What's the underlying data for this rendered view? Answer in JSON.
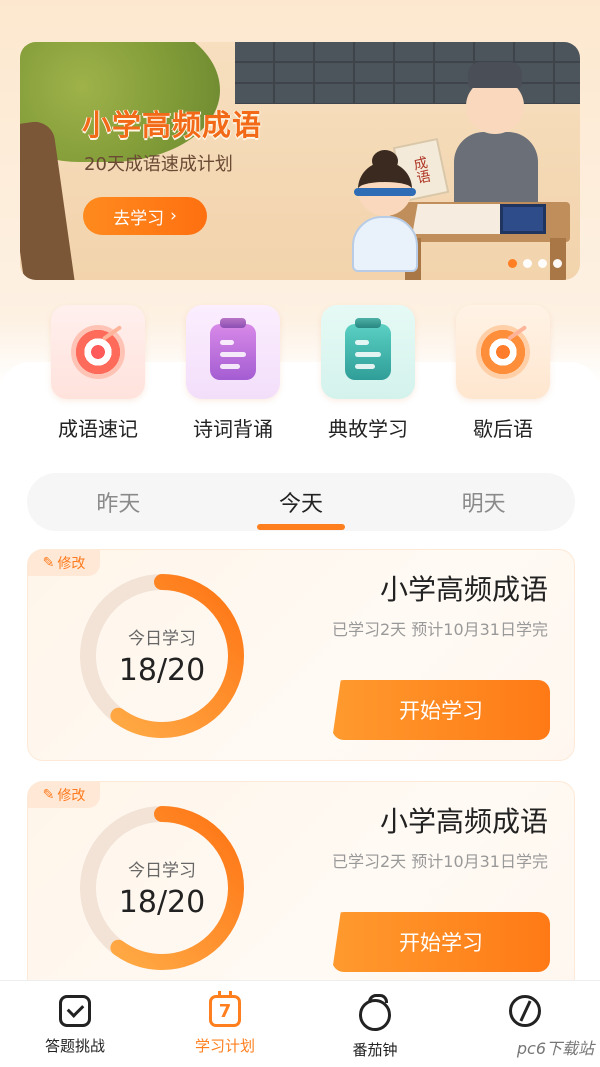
{
  "banner": {
    "title": "小学高频成语",
    "subtitle": "20天成语速成计划",
    "cta": "去学习",
    "cta_icon": "chevron-right-icon",
    "scroll_text": "成语",
    "slides": 4,
    "active_slide": 0
  },
  "categories": [
    {
      "label": "成语速记",
      "icon": "target-icon",
      "color": "#ff6b5a"
    },
    {
      "label": "诗词背诵",
      "icon": "clipboard-icon",
      "color": "#c46bd9"
    },
    {
      "label": "典故学习",
      "icon": "clipboard-icon",
      "color": "#3fb8ae"
    },
    {
      "label": "歇后语",
      "icon": "target-icon",
      "color": "#ff8a2e"
    }
  ],
  "tabs": {
    "items": [
      "昨天",
      "今天",
      "明天"
    ],
    "active": 1
  },
  "plans": [
    {
      "edit_label": "修改",
      "ring_label": "今日学习",
      "progress_text": "18/20",
      "progress": 0.6,
      "title": "小学高频成语",
      "meta": "已学习2天 预计10月31日学完",
      "start_label": "开始学习"
    },
    {
      "edit_label": "修改",
      "ring_label": "今日学习",
      "progress_text": "18/20",
      "progress": 0.6,
      "title": "小学高频成语",
      "meta": "已学习2天 预计10月31日学完",
      "start_label": "开始学习"
    }
  ],
  "nav": {
    "items": [
      {
        "label": "答题挑战",
        "icon": "checkbox-icon"
      },
      {
        "label": "学习计划",
        "icon": "calendar-icon",
        "badge": "7"
      },
      {
        "label": "番茄钟",
        "icon": "tomato-icon"
      },
      {
        "label": "",
        "icon": "leaf-icon"
      }
    ],
    "active": 1
  },
  "watermark": "pc6下载站",
  "colors": {
    "accent": "#ff7f1e",
    "title": "#f26a18"
  }
}
